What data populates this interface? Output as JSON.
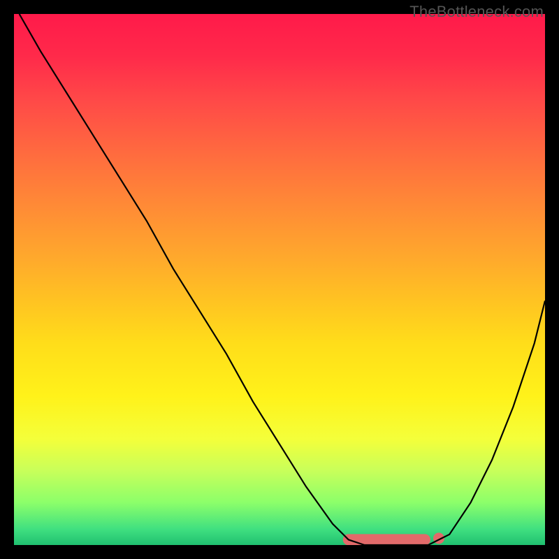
{
  "watermark": {
    "text": "TheBottleneck.com"
  },
  "chart_data": {
    "type": "line",
    "title": "",
    "xlabel": "",
    "ylabel": "",
    "xlim": [
      0,
      100
    ],
    "ylim": [
      0,
      100
    ],
    "grid": false,
    "series": [
      {
        "name": "curve",
        "x": [
          1,
          5,
          10,
          15,
          20,
          25,
          30,
          35,
          40,
          45,
          50,
          55,
          60,
          63,
          66,
          69,
          72,
          75,
          78,
          82,
          86,
          90,
          94,
          98,
          100
        ],
        "y": [
          100,
          93,
          85,
          77,
          69,
          61,
          52,
          44,
          36,
          27,
          19,
          11,
          4,
          1,
          0,
          0,
          0,
          0,
          0,
          2,
          8,
          16,
          26,
          38,
          46
        ]
      }
    ],
    "highlight_band": {
      "from_x": 63,
      "to_x": 80,
      "y": 1,
      "color": "#e06a6a"
    }
  }
}
